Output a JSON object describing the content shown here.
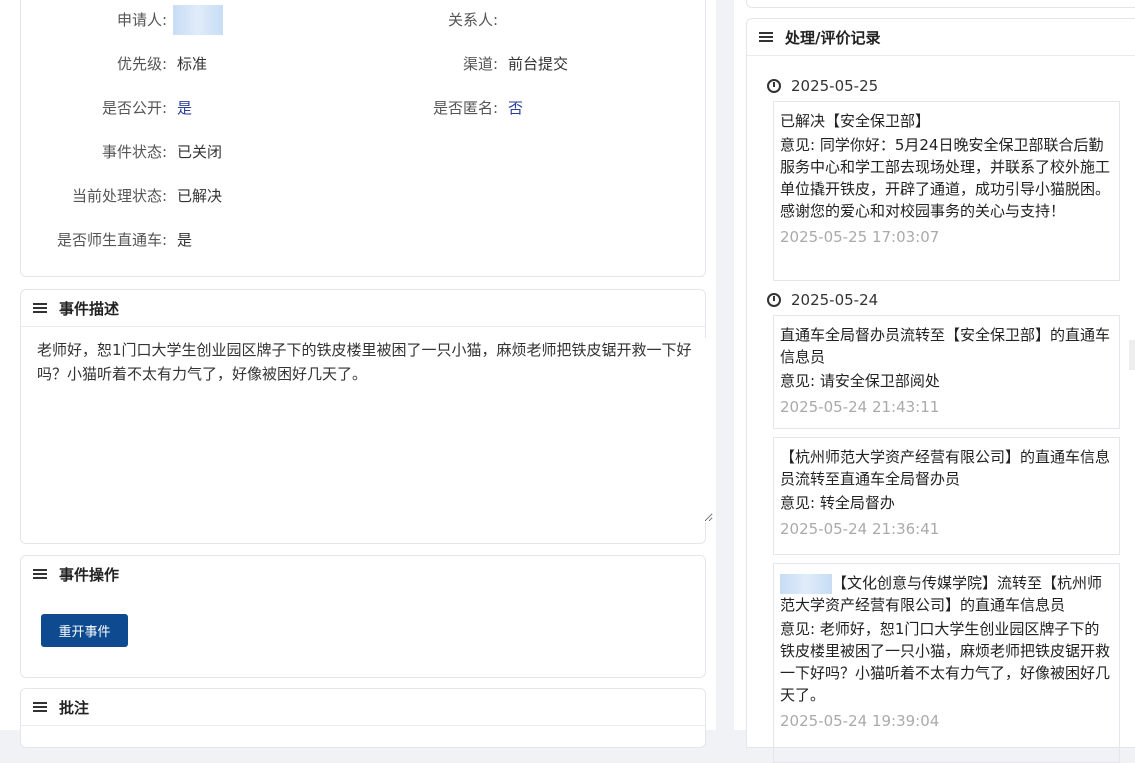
{
  "info": {
    "applicant_label": "申请人:",
    "contact_label": "关系人:",
    "priority_label": "优先级:",
    "priority_value": "标准",
    "channel_label": "渠道:",
    "channel_value": "前台提交",
    "public_label": "是否公开:",
    "public_value": "是",
    "anonymous_label": "是否匿名:",
    "anonymous_value": "否",
    "event_status_label": "事件状态:",
    "event_status_value": "已关闭",
    "process_status_label": "当前处理状态:",
    "process_status_value": "已解决",
    "direct_label": "是否师生直通车:",
    "direct_value": "是"
  },
  "description": {
    "title": "事件描述",
    "text": "老师好，恕1门口大学生创业园区牌子下的铁皮楼里被困了一只小猫，麻烦老师把铁皮锯开救一下好吗？小猫听着不太有力气了，好像被困好几天了。"
  },
  "operations": {
    "title": "事件操作",
    "reopen_label": "重开事件"
  },
  "notes": {
    "title": "批注"
  },
  "records": {
    "title": "处理/评价记录",
    "groups": [
      {
        "date": "2025-05-25",
        "items": [
          {
            "head": "已解决【安全保卫部】",
            "opinion": "意见: 同学你好：5月24日晚安全保卫部联合后勤服务中心和学工部去现场处理，并联系了校外施工单位撬开铁皮，开辟了通道，成功引导小猫脱困。感谢您的爱心和对校园事务的关心与支持！",
            "time": "2025-05-25 17:03:07"
          }
        ]
      },
      {
        "date": "2025-05-24",
        "items": [
          {
            "head": "直通车全局督办员流转至【安全保卫部】的直通车信息员",
            "opinion": "意见: 请安全保卫部阅处",
            "time": "2025-05-24 21:43:11"
          },
          {
            "head": "【杭州师范大学资产经营有限公司】的直通车信息员流转至直通车全局督办员",
            "opinion": "意见: 转全局督办",
            "time": "2025-05-24 21:36:41"
          },
          {
            "head": "【文化创意与传媒学院】流转至【杭州师范大学资产经营有限公司】的直通车信息员",
            "opinion": "意见: 老师好，恕1门口大学生创业园区牌子下的铁皮楼里被困了一只小猫，麻烦老师把铁皮锯开救一下好吗？小猫听着不太有力气了，好像被困好几天了。",
            "time": "2025-05-24 19:39:04"
          }
        ]
      }
    ]
  }
}
